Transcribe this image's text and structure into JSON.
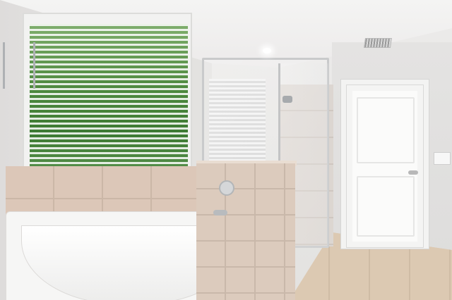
{
  "image": {
    "alt_text": "",
    "colors": {
      "wall": "#e4e3e2",
      "tile": "#dcc7b8",
      "floor": "#dbc8b1",
      "foliage": "#4f8a3f",
      "fixture": "#b8bbbe"
    }
  },
  "scene": {
    "elements": [
      "ceiling",
      "window-with-blinds",
      "bathtub",
      "glass-shower",
      "door",
      "tile-knee-wall",
      "tile-floor",
      "recessed-light",
      "air-vent",
      "towel-bar",
      "light-switch"
    ]
  }
}
